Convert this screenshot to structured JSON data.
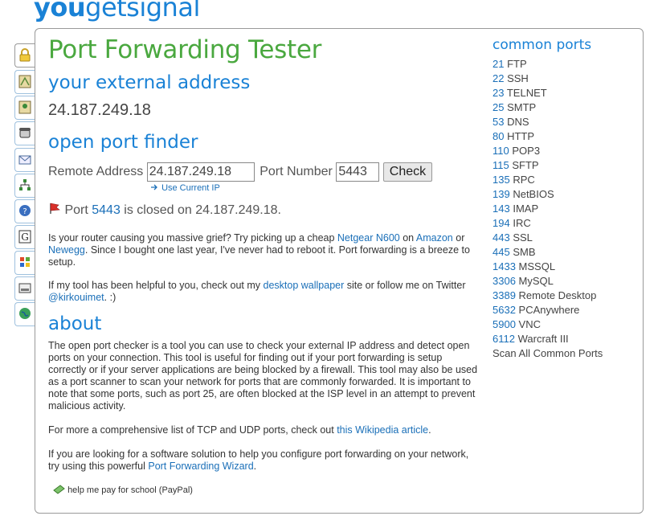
{
  "logo": {
    "part1": "you",
    "part2": "get",
    "part3": "signal"
  },
  "sidebar_tabs": [
    {
      "name": "lock-icon"
    },
    {
      "name": "map-icon"
    },
    {
      "name": "map-pin-icon"
    },
    {
      "name": "phone-icon"
    },
    {
      "name": "email-icon"
    },
    {
      "name": "network-icon"
    },
    {
      "name": "help-icon"
    },
    {
      "name": "google-icon"
    },
    {
      "name": "windows-icon"
    },
    {
      "name": "keyboard-icon"
    },
    {
      "name": "globe-icon"
    }
  ],
  "page": {
    "title": "Port Forwarding Tester",
    "external_heading": "your external address",
    "external_ip": "24.187.249.18",
    "finder_heading": "open port finder",
    "remote_label": "Remote Address",
    "remote_value": "24.187.249.18",
    "port_label": "Port Number",
    "port_value": "5443",
    "check_label": "Check",
    "use_current_ip": "Use Current IP",
    "status": {
      "pre": "Port ",
      "port": "5443",
      "post": " is closed on 24.187.249.18."
    },
    "router": {
      "t1": "Is your router causing you massive grief? Try picking up a cheap ",
      "l1": "Netgear N600",
      "t2": " on ",
      "l2": "Amazon",
      "t3": " or ",
      "l3": "Newegg",
      "t4": ". Since I bought one last year, I've never had to reboot it. Port forwarding is a breeze to setup."
    },
    "helpful": {
      "t1": "If my tool has been helpful to you, check out my ",
      "l1": "desktop wallpaper",
      "t2": " site or follow me on Twitter ",
      "l2": "@kirkouimet",
      "t3": ". :)"
    },
    "about_heading": "about",
    "about_text": "The open port checker is a tool you can use to check your external IP address and detect open ports on your connection. This tool is useful for finding out if your port forwarding is setup correctly or if your server applications are being blocked by a firewall. This tool may also be used as a port scanner to scan your network for ports that are commonly forwarded. It is important to note that some ports, such as port 25, are often blocked at the ISP level in an attempt to prevent malicious activity.",
    "wiki": {
      "t1": "For more a comprehensive list of TCP and UDP ports, check out ",
      "l1": "this Wikipedia article",
      "t2": "."
    },
    "wizard": {
      "t1": "If you are looking for a software solution to help you configure port forwarding on your network, try using this powerful ",
      "l1": "Port Forwarding Wizard",
      "t2": "."
    },
    "paypal": "help me pay for school (PayPal)"
  },
  "common_ports": {
    "heading": "common ports",
    "items": [
      {
        "port": "21",
        "name": "FTP"
      },
      {
        "port": "22",
        "name": "SSH"
      },
      {
        "port": "23",
        "name": "TELNET"
      },
      {
        "port": "25",
        "name": "SMTP"
      },
      {
        "port": "53",
        "name": "DNS"
      },
      {
        "port": "80",
        "name": "HTTP"
      },
      {
        "port": "110",
        "name": "POP3"
      },
      {
        "port": "115",
        "name": "SFTP"
      },
      {
        "port": "135",
        "name": "RPC"
      },
      {
        "port": "139",
        "name": "NetBIOS"
      },
      {
        "port": "143",
        "name": "IMAP"
      },
      {
        "port": "194",
        "name": "IRC"
      },
      {
        "port": "443",
        "name": "SSL"
      },
      {
        "port": "445",
        "name": "SMB"
      },
      {
        "port": "1433",
        "name": "MSSQL"
      },
      {
        "port": "3306",
        "name": "MySQL"
      },
      {
        "port": "3389",
        "name": "Remote Desktop"
      },
      {
        "port": "5632",
        "name": "PCAnywhere"
      },
      {
        "port": "5900",
        "name": "VNC"
      },
      {
        "port": "6112",
        "name": "Warcraft III"
      }
    ],
    "scan_all": "Scan All Common Ports"
  }
}
